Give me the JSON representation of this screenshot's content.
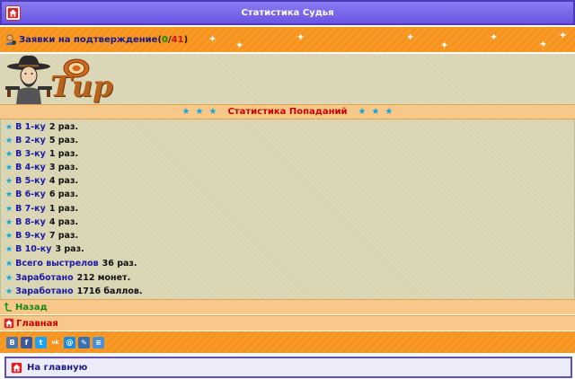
{
  "header": {
    "title": "Статистика Судья"
  },
  "confirm": {
    "label": "Заявки на подтверждение",
    "open_paren": "(",
    "accepted": "0",
    "slash": "/",
    "total": "41",
    "close_paren": ")"
  },
  "banner": {
    "logo_text": "Тир"
  },
  "section": {
    "title": "Статистика Попаданий"
  },
  "stats": [
    {
      "label": "В 1-ку",
      "value": "2 раз."
    },
    {
      "label": "В 2-ку",
      "value": "5 раз."
    },
    {
      "label": "В 3-ку",
      "value": "1 раз."
    },
    {
      "label": "В 4-ку",
      "value": "3 раз."
    },
    {
      "label": "В 5-ку",
      "value": "4 раз."
    },
    {
      "label": "В 6-ку",
      "value": "6 раз."
    },
    {
      "label": "В 7-ку",
      "value": "1 раз."
    },
    {
      "label": "В 8-ку",
      "value": "4 раз."
    },
    {
      "label": "В 9-ку",
      "value": "7 раз."
    },
    {
      "label": "В 10-ку",
      "value": "3 раз."
    },
    {
      "label": "Всего выстрелов",
      "value": "36 раз."
    },
    {
      "label": "Заработано",
      "value": "212 монет."
    },
    {
      "label": "Заработано",
      "value": "1716 баллов."
    }
  ],
  "nav": {
    "back_label": "Назад",
    "main_label": "Главная"
  },
  "social": [
    {
      "icon": "vkontakte-icon",
      "glyph": "В",
      "color": "#4a76a8"
    },
    {
      "icon": "facebook-icon",
      "glyph": "f",
      "color": "#3b5998"
    },
    {
      "icon": "twitter-icon",
      "glyph": "t",
      "color": "#1da1f2"
    },
    {
      "icon": "odnoklassniki-icon",
      "glyph": "ok",
      "color": "#f7931e"
    },
    {
      "icon": "mail-icon",
      "glyph": "@",
      "color": "#168de2"
    },
    {
      "icon": "livejournal-icon",
      "glyph": "✎",
      "color": "#3a6fb0"
    },
    {
      "icon": "share-icon",
      "glyph": "≡",
      "color": "#4a90d9"
    }
  ],
  "footer": {
    "home_label": "На главную"
  },
  "colors": {
    "header": "#7b68ee",
    "orange": "#f7941d",
    "stats_bg": "#d8d4b2",
    "star": "#1aa3d6"
  }
}
